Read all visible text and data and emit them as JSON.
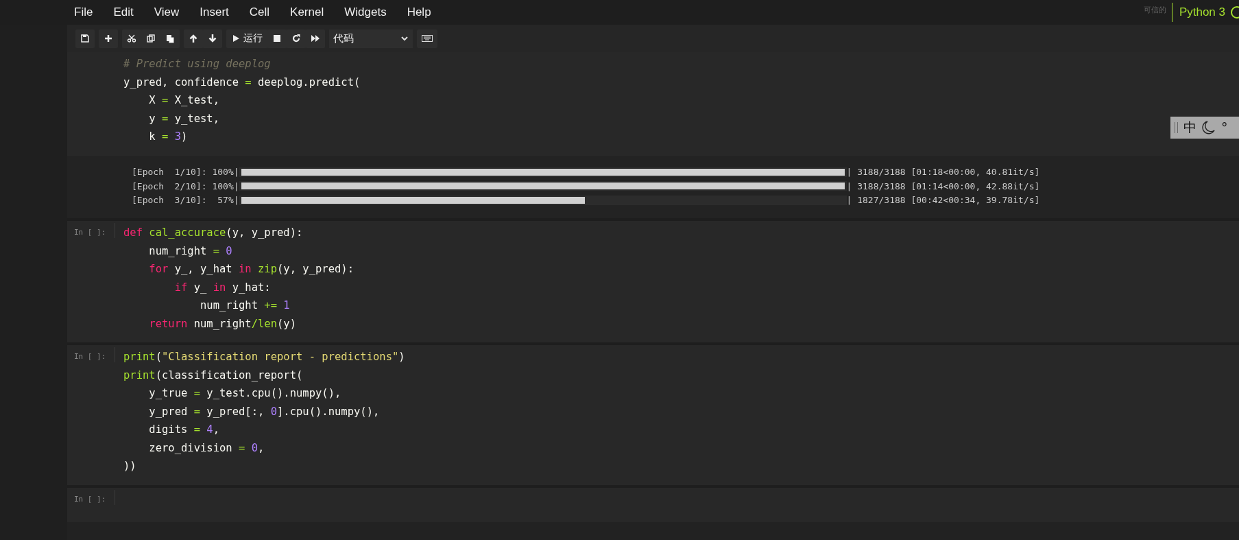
{
  "menu": [
    "File",
    "Edit",
    "View",
    "Insert",
    "Cell",
    "Kernel",
    "Widgets",
    "Help"
  ],
  "kernel": {
    "trust": "可信的",
    "name": "Python 3"
  },
  "toolbar": {
    "run_label": "运行",
    "cell_type": "代码"
  },
  "ime": {
    "mode": "中",
    "extra": "°"
  },
  "cells": [
    {
      "lines": [
        [
          {
            "kind": "comment",
            "text": "# Predict using deeplog"
          }
        ],
        [
          {
            "kind": "plain",
            "text": "y_pred, confidence "
          },
          {
            "kind": "op",
            "text": "="
          },
          {
            "kind": "plain",
            "text": " deeplog.predict("
          }
        ],
        [
          {
            "kind": "plain",
            "text": "    X "
          },
          {
            "kind": "op",
            "text": "="
          },
          {
            "kind": "plain",
            "text": " X_test,"
          }
        ],
        [
          {
            "kind": "plain",
            "text": "    y "
          },
          {
            "kind": "op",
            "text": "="
          },
          {
            "kind": "plain",
            "text": " y_test,"
          }
        ],
        [
          {
            "kind": "plain",
            "text": "    k "
          },
          {
            "kind": "op",
            "text": "= "
          },
          {
            "kind": "num",
            "text": "3"
          },
          {
            "kind": "plain",
            "text": ")"
          }
        ]
      ],
      "progress": [
        {
          "label": "[Epoch  1/10]: 100%|",
          "level": 1,
          "stats": "| 3188/3188 [01:18<00:00, 40.81it/s]"
        },
        {
          "label": "[Epoch  2/10]: 100%|",
          "level": 1,
          "stats": "| 3188/3188 [01:14<00:00, 42.88it/s]"
        },
        {
          "label": "[Epoch  3/10]:  57%|",
          "level": 0.57,
          "stats": "| 1827/3188 [00:42<00:34, 39.78it/s]"
        }
      ]
    },
    {
      "prompt": "In [ ]:",
      "lines": [
        [
          {
            "kind": "keyword",
            "text": "def "
          },
          {
            "kind": "func",
            "text": "cal_accurace"
          },
          {
            "kind": "plain",
            "text": "(y, y_pred):"
          }
        ],
        [
          {
            "kind": "plain",
            "text": "    num_right "
          },
          {
            "kind": "op",
            "text": "= "
          },
          {
            "kind": "num",
            "text": "0"
          }
        ],
        [
          {
            "kind": "keyword",
            "text": "    for"
          },
          {
            "kind": "plain",
            "text": " y_, y_hat "
          },
          {
            "kind": "keyword",
            "text": "in "
          },
          {
            "kind": "func",
            "text": "zip"
          },
          {
            "kind": "plain",
            "text": "(y, y_pred):"
          }
        ],
        [
          {
            "kind": "keyword",
            "text": "        if"
          },
          {
            "kind": "plain",
            "text": " y_ "
          },
          {
            "kind": "keyword",
            "text": "in"
          },
          {
            "kind": "plain",
            "text": " y_hat:"
          }
        ],
        [
          {
            "kind": "plain",
            "text": "            num_right "
          },
          {
            "kind": "op",
            "text": "+= "
          },
          {
            "kind": "num",
            "text": "1"
          }
        ],
        [
          {
            "kind": "keyword",
            "text": "    return"
          },
          {
            "kind": "plain",
            "text": " num_right"
          },
          {
            "kind": "op",
            "text": "/"
          },
          {
            "kind": "func",
            "text": "len"
          },
          {
            "kind": "plain",
            "text": "(y)"
          }
        ]
      ]
    },
    {
      "prompt": "In [ ]:",
      "lines": [
        [
          {
            "kind": "func",
            "text": "print"
          },
          {
            "kind": "plain",
            "text": "("
          },
          {
            "kind": "string",
            "text": "\"Classification report - predictions\""
          },
          {
            "kind": "plain",
            "text": ")"
          }
        ],
        [
          {
            "kind": "func",
            "text": "print"
          },
          {
            "kind": "plain",
            "text": "(classification_report("
          }
        ],
        [
          {
            "kind": "plain",
            "text": "    y_true "
          },
          {
            "kind": "op",
            "text": "="
          },
          {
            "kind": "plain",
            "text": " y_test.cpu().numpy(),"
          }
        ],
        [
          {
            "kind": "plain",
            "text": "    y_pred "
          },
          {
            "kind": "op",
            "text": "="
          },
          {
            "kind": "plain",
            "text": " y_pred[:, "
          },
          {
            "kind": "num",
            "text": "0"
          },
          {
            "kind": "plain",
            "text": "].cpu().numpy(),"
          }
        ],
        [
          {
            "kind": "plain",
            "text": "    digits "
          },
          {
            "kind": "op",
            "text": "= "
          },
          {
            "kind": "num",
            "text": "4"
          },
          {
            "kind": "plain",
            "text": ","
          }
        ],
        [
          {
            "kind": "plain",
            "text": "    zero_division "
          },
          {
            "kind": "op",
            "text": "= "
          },
          {
            "kind": "num",
            "text": "0"
          },
          {
            "kind": "plain",
            "text": ","
          }
        ],
        [
          {
            "kind": "plain",
            "text": "))"
          }
        ]
      ]
    },
    {
      "prompt": "In [ ]:"
    }
  ]
}
